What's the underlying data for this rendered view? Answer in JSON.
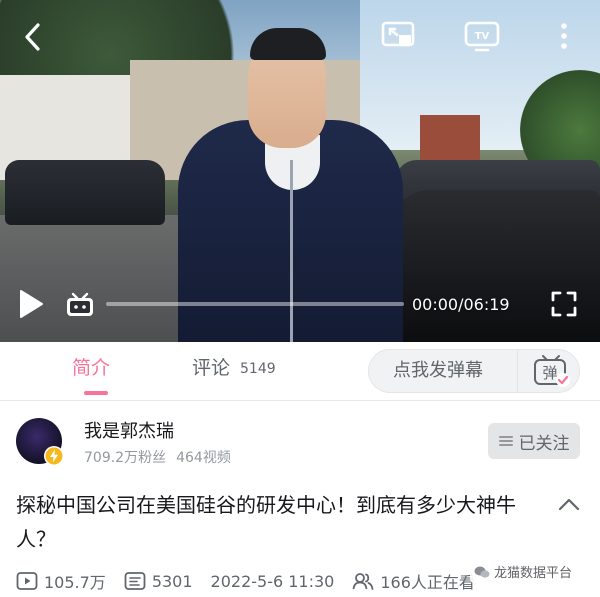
{
  "player": {
    "time_current": "00:00",
    "time_total": "06:19",
    "time_display": "00:00/06:19",
    "progress": 0
  },
  "tabs": {
    "intro_label": "简介",
    "comment_label": "评论",
    "comment_count": "5149"
  },
  "danmaku": {
    "placeholder": "点我发弹幕",
    "button_label": "弹"
  },
  "uploader": {
    "name": "我是郭杰瑞",
    "fans": "709.2万粉丝",
    "videos": "464视频",
    "follow_label": "已关注"
  },
  "video": {
    "title": "探秘中国公司在美国硅谷的研发中心！到底有多少大神牛人？",
    "views": "105.7万",
    "danmaku_count": "5301",
    "date": "2022-5-6 11:30",
    "watching": "166人正在看"
  },
  "watermark": {
    "text": "龙猫数据平台"
  },
  "colors": {
    "accent": "#fb7299",
    "text_primary": "#18191c",
    "text_secondary": "#61666d",
    "text_muted": "#9499a0",
    "button_bg": "#e3e5e7"
  },
  "icons": {
    "back": "back-arrow-icon",
    "cast": "cast-screen-icon",
    "tv": "tv-cast-icon",
    "more": "more-vertical-icon",
    "play": "play-icon",
    "bili": "bilibili-tv-icon",
    "fullscreen": "fullscreen-icon",
    "danmaku": "danmaku-icon",
    "verified": "verified-lightning-icon",
    "expand": "chevron-up-icon",
    "views": "play-count-icon",
    "danmaku_count": "danmaku-count-icon",
    "watching": "watching-people-icon"
  }
}
